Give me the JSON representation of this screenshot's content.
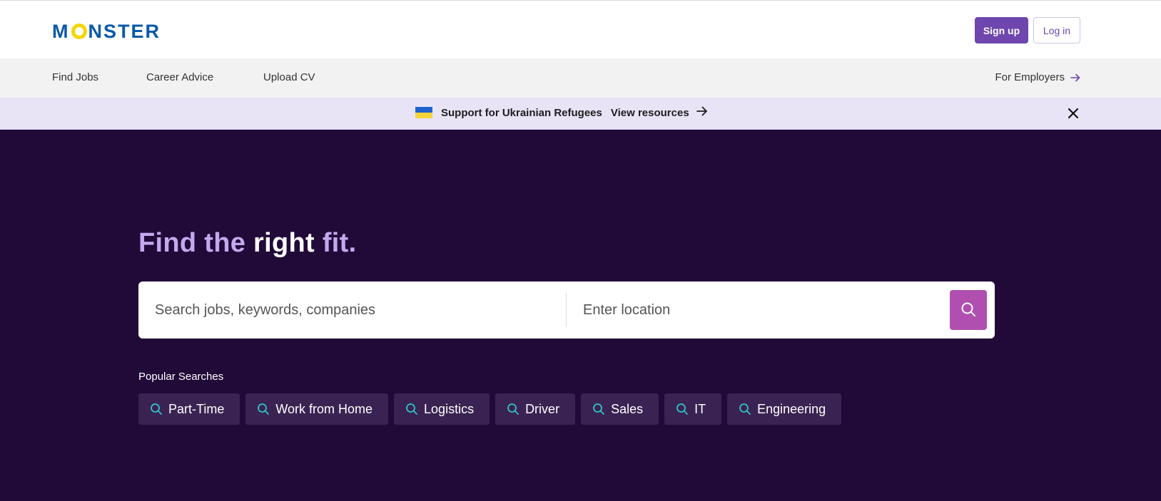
{
  "header": {
    "logo_text": "MONSTER",
    "signup_label": "Sign up",
    "login_label": "Log in"
  },
  "nav": {
    "items": [
      {
        "label": "Find Jobs"
      },
      {
        "label": "Career Advice"
      },
      {
        "label": "Upload CV"
      }
    ],
    "employers_label": "For Employers"
  },
  "banner": {
    "title": "Support for Ukrainian Refugees",
    "link": "View resources"
  },
  "hero": {
    "headline_part1": "Find the",
    "headline_part2": "right",
    "headline_part3": "fit.",
    "search_placeholder": "Search jobs, keywords, companies",
    "location_placeholder": "Enter location",
    "popular_label": "Popular Searches",
    "chips": [
      {
        "label": "Part-Time"
      },
      {
        "label": "Work from Home"
      },
      {
        "label": "Logistics"
      },
      {
        "label": "Driver"
      },
      {
        "label": "Sales"
      },
      {
        "label": "IT"
      },
      {
        "label": "Engineering"
      }
    ]
  },
  "colors": {
    "brand_blue": "#0a59a8",
    "brand_yellow": "#f6d500",
    "accent_purple": "#6e46ae",
    "hero_bg": "#210a38",
    "search_button": "#b04fb0",
    "chip_icon": "#2fc4c8"
  }
}
